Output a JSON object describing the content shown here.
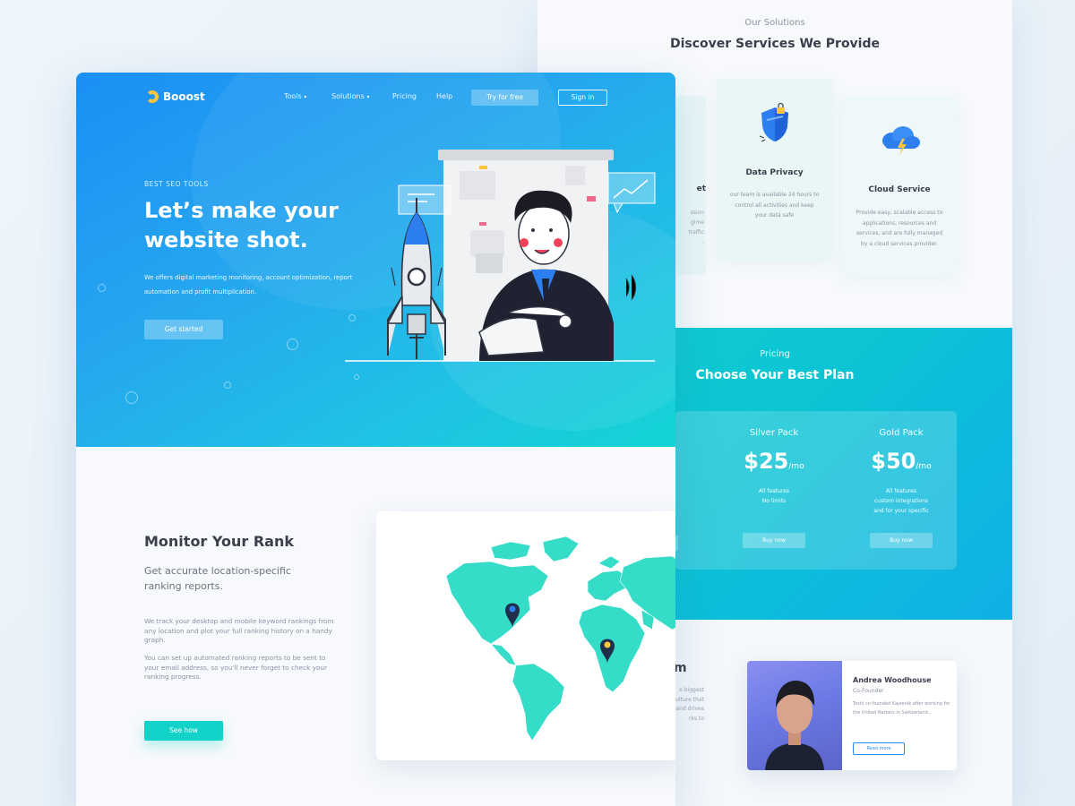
{
  "solutions": {
    "eyebrow": "Our Solutions",
    "title": "Discover Services We Provide",
    "partial_card": {
      "title": "et",
      "lines": [
        "ssion",
        "gime",
        "traffic",
        "."
      ]
    },
    "cards": [
      {
        "title": "Data Privacy",
        "icon": "shield-lock-icon",
        "desc": "our team is available 24 hours to control all activities and keep your data safe"
      },
      {
        "title": "Cloud Service",
        "icon": "cloud-bolt-icon",
        "desc": "Provide easy, scalable access to applications, resources and services, and are fully managed by a cloud services provider."
      }
    ]
  },
  "pricing": {
    "eyebrow": "Pricing",
    "title": "Choose Your Best Plan",
    "plans": [
      {
        "name": "Silver Pack",
        "price": "$25",
        "unit": "/mo",
        "features": [
          "All features",
          "No limits"
        ],
        "button": "Buy now"
      },
      {
        "name": "Gold Pack",
        "price": "$50",
        "unit": "/mo",
        "features": [
          "All features",
          "custom integrations",
          "and for your specific"
        ],
        "button": "Buy now"
      }
    ]
  },
  "team": {
    "heading_fragment": "m",
    "partial_lines": [
      "e biggest",
      "culture that",
      "and drives",
      "rks to"
    ],
    "profile": {
      "name": "Andrea Woodhouse",
      "role": "Co-Founder",
      "bio": "Toshi co-founded Kajeenik after working for the United Nations in Switzerland...",
      "button": "Read more"
    }
  },
  "hero": {
    "brand": "Booost",
    "nav": [
      {
        "label": "Tools",
        "dropdown": true
      },
      {
        "label": "Solutions",
        "dropdown": true
      },
      {
        "label": "Pricing",
        "dropdown": false
      },
      {
        "label": "Help",
        "dropdown": false
      }
    ],
    "try_free": "Try for free",
    "sign_in": "Sign in",
    "eyebrow": "BEST SEO TOOLS",
    "title": "Let’s make your website shot.",
    "description": "We offers digital marketing monitoring, account optimization, report automation and profit multiplication.",
    "cta": "Get started"
  },
  "rank": {
    "title": "Monitor Your Rank",
    "subtitle": "Get accurate location-specific ranking reports.",
    "paragraphs": [
      "We track your desktop and mobile keyword rankings from any location and plot your full ranking history on a handy graph.",
      "You can set up automated ranking reports to be sent to your email address, so you'll never forget to check your ranking progress."
    ],
    "cta": "See how"
  },
  "colors": {
    "accent_teal": "#13d3c9",
    "hero_blue": "#1b8ff5",
    "logo_yellow": "#ffc53d",
    "map_teal": "#35dcc8"
  }
}
